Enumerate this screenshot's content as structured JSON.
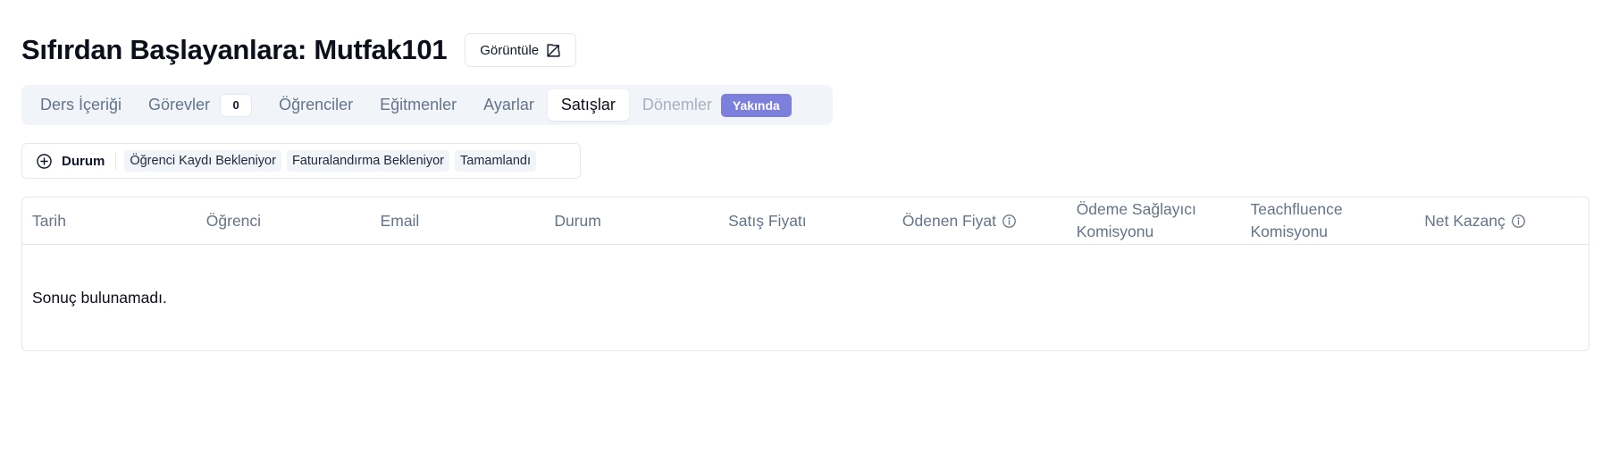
{
  "header": {
    "title": "Sıfırdan Başlayanlara: Mutfak101",
    "view_button_label": "Görüntüle"
  },
  "tabs": [
    {
      "label": "Ders İçeriği",
      "state": "default"
    },
    {
      "label": "Görevler",
      "state": "default",
      "badge": "0"
    },
    {
      "label": "Öğrenciler",
      "state": "default"
    },
    {
      "label": "Eğitmenler",
      "state": "default"
    },
    {
      "label": "Ayarlar",
      "state": "default"
    },
    {
      "label": "Satışlar",
      "state": "active"
    },
    {
      "label": "Dönemler",
      "state": "disabled",
      "tag": "Yakında"
    }
  ],
  "filter": {
    "status_label": "Durum",
    "options": [
      "Öğrenci Kaydı Bekleniyor",
      "Faturalandırma Bekleniyor",
      "Tamamlandı"
    ]
  },
  "table": {
    "columns": [
      {
        "label": "Tarih",
        "info": false
      },
      {
        "label": "Öğrenci",
        "info": false
      },
      {
        "label": "Email",
        "info": false
      },
      {
        "label": "Durum",
        "info": false
      },
      {
        "label": "Satış Fiyatı",
        "info": false
      },
      {
        "label": "Ödenen Fiyat",
        "info": true
      },
      {
        "label": "Ödeme Sağlayıcı Komisyonu",
        "info": false
      },
      {
        "label": "Teachfluence Komisyonu",
        "info": false
      },
      {
        "label": "Net Kazanç",
        "info": true
      }
    ],
    "empty_message": "Sonuç bulunamadı."
  },
  "colors": {
    "accent_badge": "#7c7fdc",
    "tab_bar_bg": "#f1f5f9",
    "muted_text": "#64748b"
  }
}
